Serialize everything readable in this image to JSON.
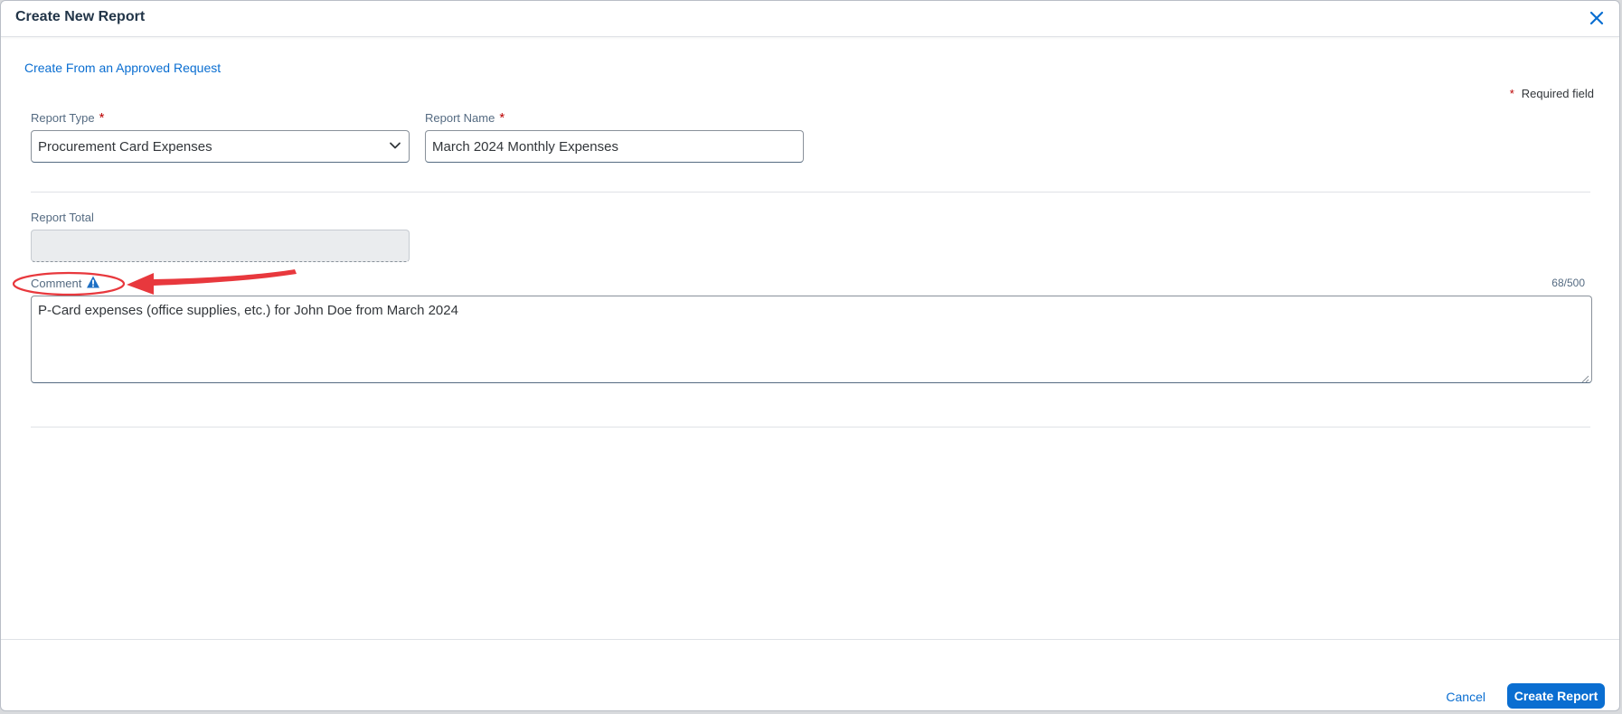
{
  "dialog": {
    "title": "Create New Report",
    "close_icon": "close-icon"
  },
  "links": {
    "approved_request": "Create From an Approved Request"
  },
  "required_note": {
    "star": "*",
    "text": "Required field"
  },
  "form": {
    "report_type": {
      "label": "Report Type",
      "star": "*",
      "value": "Procurement Card Expenses",
      "icon": "chevron-down-icon"
    },
    "report_name": {
      "label": "Report Name",
      "star": "*",
      "value": "March 2024 Monthly Expenses"
    },
    "report_total": {
      "label": "Report Total",
      "value": ""
    },
    "comment": {
      "label": "Comment",
      "icon": "warning-info-icon",
      "counter": "68/500",
      "value": "P-Card expenses (office supplies, etc.) for John Doe from March 2024"
    }
  },
  "annotation": {
    "color": "#e8383d",
    "shapes": "ellipse-and-arrow"
  },
  "footer": {
    "cancel_label": "Cancel",
    "create_label": "Create Report"
  },
  "colors": {
    "accent": "#0a6ed1",
    "required": "#bb0000"
  }
}
